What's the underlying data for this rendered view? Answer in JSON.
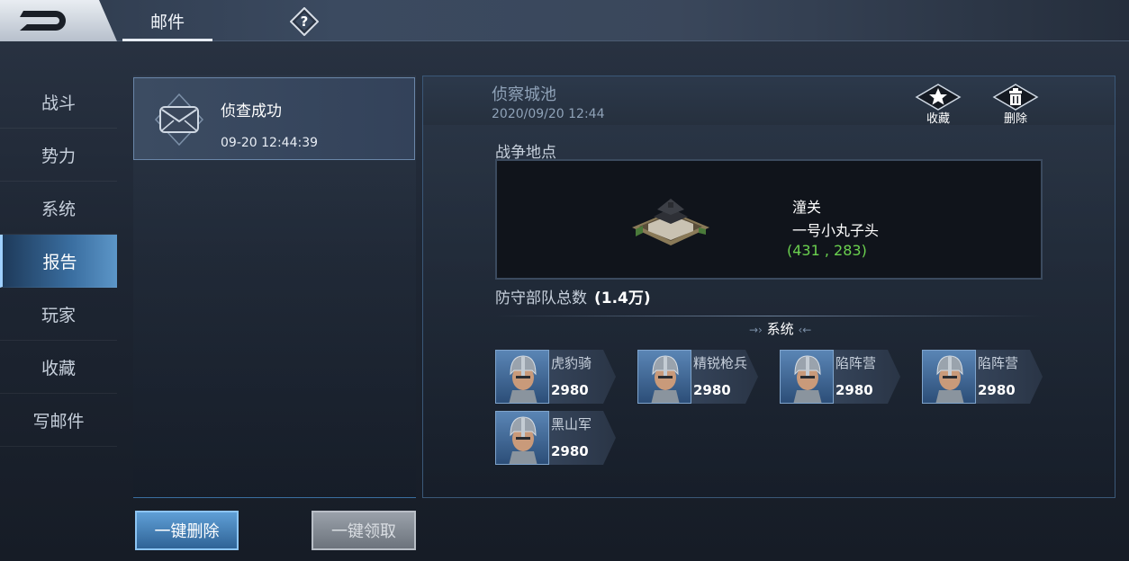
{
  "topbar": {
    "tab_label": "邮件",
    "help_symbol": "?"
  },
  "sidebar": {
    "items": [
      {
        "label": "战斗",
        "active": false
      },
      {
        "label": "势力",
        "active": false
      },
      {
        "label": "系统",
        "active": false
      },
      {
        "label": "报告",
        "active": true
      },
      {
        "label": "玩家",
        "active": false
      },
      {
        "label": "收藏",
        "active": false
      },
      {
        "label": "写邮件",
        "active": false
      }
    ]
  },
  "mail_list": {
    "items": [
      {
        "title": "侦查成功",
        "time": "09-20 12:44:39"
      }
    ],
    "delete_all_label": "一键删除",
    "claim_all_label": "一键领取"
  },
  "detail": {
    "title": "侦察城池",
    "date": "2020/09/20 12:44",
    "favorite_label": "收藏",
    "delete_label": "删除",
    "battle_location_label": "战争地点",
    "location": {
      "name": "潼关",
      "owner": "一号小丸子头",
      "coords": "(431 , 283)"
    },
    "defense_label": "防守部队总数",
    "defense_value": "(1.4万)",
    "divider_label": "系统",
    "troops": [
      {
        "name": "虎豹骑",
        "count": "2980"
      },
      {
        "name": "精锐枪兵",
        "count": "2980"
      },
      {
        "name": "陷阵营",
        "count": "2980"
      },
      {
        "name": "陷阵营",
        "count": "2980"
      },
      {
        "name": "黑山军",
        "count": "2980"
      }
    ]
  },
  "colors": {
    "accent": "#5c96c8",
    "coords_green": "#6bd14f"
  }
}
